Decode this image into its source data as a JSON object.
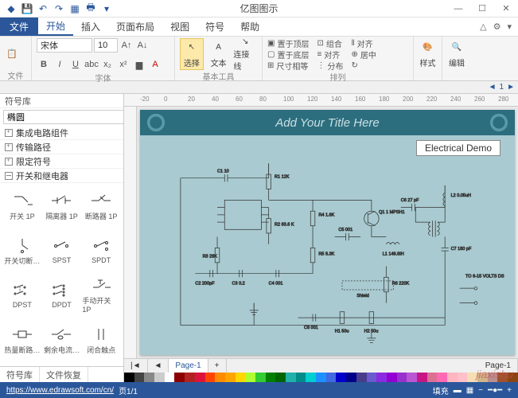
{
  "app": {
    "title": "亿图图示"
  },
  "qat": [
    "save",
    "undo",
    "redo",
    "preview",
    "print",
    "export"
  ],
  "window": {
    "min": "—",
    "max": "☐",
    "close": "✕"
  },
  "tabs": {
    "file": "文件",
    "items": [
      "开始",
      "插入",
      "页面布局",
      "视图",
      "符号",
      "帮助"
    ],
    "active": "开始"
  },
  "ribbon": {
    "file_group": "文件",
    "font": {
      "name": "宋体",
      "size": "10",
      "label": "字体"
    },
    "tools": {
      "select": "选择",
      "text": "文本",
      "connector": "连接线",
      "label": "基本工具"
    },
    "arrange": {
      "top": "置于顶层",
      "group": "组合",
      "align": "对齐",
      "bottom": "置于底层",
      "align2": "对齐",
      "center": "居中",
      "size": "尺寸相等",
      "dist": "分布",
      "label": "排列"
    },
    "style": "样式",
    "edit": "编辑"
  },
  "scrollstrip": {
    "left": "◄",
    "num": "1",
    "right": "►"
  },
  "sidebar": {
    "title": "符号库",
    "search": "椭圆",
    "libs": [
      {
        "name": "集成电路组件",
        "open": false
      },
      {
        "name": "传输路径",
        "open": false
      },
      {
        "name": "限定符号",
        "open": false
      },
      {
        "name": "开关和继电器",
        "open": true
      }
    ],
    "shapes": [
      "开关 1P",
      "隔离器 1P",
      "断路器 1P",
      "开关切断…",
      "SPST",
      "SPDT",
      "DPST",
      "DPDT",
      "手动开关 1P",
      "热量断路…",
      "剩余电流…",
      "闭合触点"
    ],
    "footer": [
      "符号库",
      "文件恢复"
    ]
  },
  "canvas": {
    "ruler_marks": [
      "-20",
      "0",
      "20",
      "40",
      "60",
      "80",
      "100",
      "120",
      "140",
      "160",
      "180",
      "200",
      "220",
      "240",
      "260",
      "280"
    ],
    "title": "Add Your Title Here",
    "demo_label": "Electrical Demo",
    "components": {
      "c1": "C1 10",
      "r1": "R1\n12K",
      "r2": "R2\n63.6\nK",
      "r3": "R3\n28K",
      "c2": "C2 200pF",
      "c3": "C3 0.2",
      "c4": "C4 001",
      "r4": "R4\n1.6K",
      "r5": "R5\n8.3K",
      "c5": "C5 001",
      "q1": "Q1 1\nMPSH1",
      "l1": "L1\n149.8IH",
      "r6": "R6\n220K",
      "c6": "C6 27 pF",
      "l2": "L2\n0.05uH",
      "c7": "C7 180\npF",
      "c8": "C8 001",
      "h1": "H1\n50u",
      "h2": "H2\n50u",
      "shield": "Shield",
      "out": "TO\n6-15\nVOLTS\nDS"
    }
  },
  "pagetabs": {
    "nav": [
      "|◄",
      "◄",
      "►",
      "►|"
    ],
    "page": "Page-1",
    "add": "+"
  },
  "colors": [
    "#000",
    "#444",
    "#888",
    "#ccc",
    "#fff",
    "#8b0000",
    "#b22222",
    "#dc143c",
    "#ff4500",
    "#ff8c00",
    "#ffa500",
    "#ffd700",
    "#adff2f",
    "#32cd32",
    "#008000",
    "#006400",
    "#20b2aa",
    "#008b8b",
    "#00ced1",
    "#1e90ff",
    "#4169e1",
    "#0000cd",
    "#00008b",
    "#483d8b",
    "#6a5acd",
    "#8a2be2",
    "#9400d3",
    "#9932cc",
    "#ba55d3",
    "#c71585",
    "#db7093",
    "#ff69b4",
    "#ffb6c1",
    "#ffc0cb",
    "#f5deb3",
    "#d2b48c",
    "#bc8f8f",
    "#a0522d",
    "#8b4513"
  ],
  "status": {
    "url": "https://www.edrawsoft.com/cn/",
    "page": "页1/1",
    "fill": "填充"
  },
  "watermark": "jiaxishu"
}
